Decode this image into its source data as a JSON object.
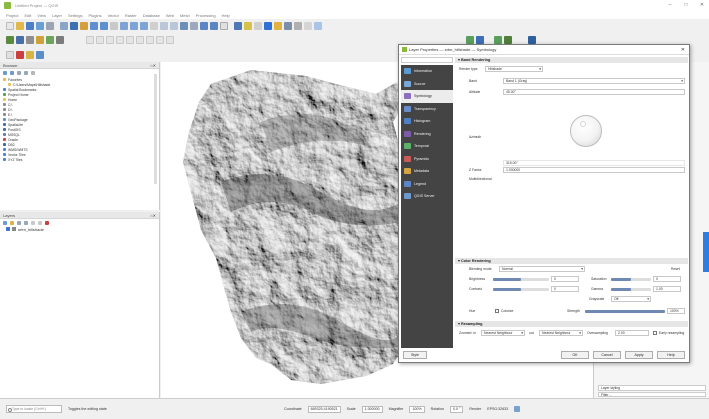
{
  "app": {
    "title": "Untitled Project — QGIS",
    "menu": [
      "Project",
      "Edit",
      "View",
      "Layer",
      "Settings",
      "Plugins",
      "Vector",
      "Raster",
      "Database",
      "Web",
      "Mesh",
      "Processing",
      "Help"
    ]
  },
  "browser": {
    "title": "Browser",
    "items": [
      "Favorites",
      "C:\\Users\\Maps\\Hillshade",
      "Spatial Bookmarks",
      "Project Home",
      "Home",
      "C:\\",
      "D:\\",
      "E:\\",
      "GeoPackage",
      "SpatiaLite",
      "PostGIS",
      "MSSQL",
      "Oracle",
      "DB2",
      "WMS/WMTS",
      "Vector Tiles",
      "XYZ Tiles"
    ]
  },
  "layers": {
    "title": "Layers",
    "items": [
      {
        "name": "srtm_hillshade",
        "checked": true
      }
    ]
  },
  "dialog": {
    "title": "Layer Properties — srtm_hillshade — Symbology",
    "close": "✕",
    "sidebar": [
      {
        "label": "Information",
        "color": "#5a9bd4"
      },
      {
        "label": "Source",
        "color": "#7aa6d8"
      },
      {
        "label": "Symbology",
        "color": "#8a6fbe",
        "active": true
      },
      {
        "label": "Transparency",
        "color": "#6a8ccc"
      },
      {
        "label": "Histogram",
        "color": "#4f7fc4"
      },
      {
        "label": "Rendering",
        "color": "#7c5ca8"
      },
      {
        "label": "Temporal",
        "color": "#5bb06a"
      },
      {
        "label": "Pyramids",
        "color": "#c95a5a"
      },
      {
        "label": "Metadata",
        "color": "#d7a442"
      },
      {
        "label": "Legend",
        "color": "#5d86c6"
      },
      {
        "label": "QGIS Server",
        "color": "#6e99cf"
      }
    ],
    "band_rendering": {
      "header": "Band Rendering",
      "render_type_label": "Render type",
      "render_type_value": "Hillshade",
      "band_label": "Band",
      "band_value": "Band 1 (Gray)",
      "altitude_label": "Altitude",
      "altitude_value": "45.00°",
      "azimuth_label": "Azimuth",
      "azimuth_value": "315.00°",
      "zfactor_label": "Z Factor",
      "zfactor_value": "1.000000",
      "multidirectional_label": "Multidirectional"
    },
    "color_rendering": {
      "header": "Color Rendering",
      "blending_label": "Blending mode",
      "blending_value": "Normal",
      "reset_label": "Reset",
      "brightness_label": "Brightness",
      "brightness_value": "0",
      "contrast_label": "Contrast",
      "contrast_value": "0",
      "gamma_label": "Gamma",
      "gamma_value": "1.00",
      "saturation_label": "Saturation",
      "saturation_value": "0",
      "grayscale_label": "Grayscale",
      "grayscale_value": "Off",
      "hue_label": "Hue",
      "colorize_label": "Colorize",
      "strength_label": "Strength",
      "strength_value": "100%"
    },
    "resampling": {
      "header": "Resampling",
      "zoomed_in_label": "Zoomed: in",
      "zoomed_in_value": "Nearest Neighbour",
      "zoomed_out_label": "out",
      "zoomed_out_value": "Nearest Neighbour",
      "oversampling_label": "Oversampling",
      "oversampling_value": "2.00",
      "early_resampling_label": "Early resampling"
    },
    "buttons": {
      "style": "Style",
      "ok": "OK",
      "cancel": "Cancel",
      "apply": "Apply",
      "help": "Help"
    }
  },
  "right_panel": {
    "field1": "Layer styling",
    "field2": "Filter…"
  },
  "status": {
    "search_placeholder": "Type to locate (Ctrl+K)",
    "message": "Toggles the editing state",
    "coordinate_label": "Coordinate",
    "coordinate_value": "689325,4190521",
    "scale_label": "Scale",
    "scale_value": "1:300000",
    "magnifier_label": "Magnifier",
    "magnifier_value": "100%",
    "rotation_label": "Rotation",
    "rotation_value": "0.0 °",
    "render_label": "Render",
    "crs_label": "EPSG:32633"
  },
  "colors": {
    "dialog_sidebar": "#444444",
    "accent": "#2e7de1",
    "hillshade_light": "#d8d8d8",
    "hillshade_dark": "#3a3a3a"
  }
}
